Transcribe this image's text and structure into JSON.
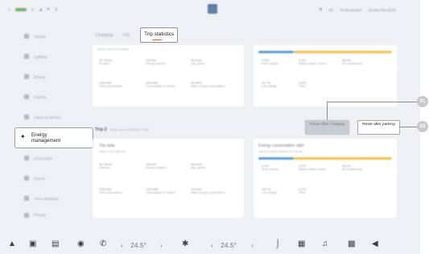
{
  "status_bar": {
    "left": [
      "≡",
      "⊙",
      "◢",
      "⚑",
      "⬆"
    ],
    "right": [
      "✱",
      "5G",
      "Ts Iks service",
      "16 Mar Sat 19:52"
    ]
  },
  "sidebar": {
    "items": [
      {
        "label": "Vehicle",
        "icon": "car-icon"
      },
      {
        "label": "Lighting",
        "icon": "light-icon"
      },
      {
        "label": "Driving",
        "icon": "steering-icon"
      },
      {
        "label": "Exterior",
        "icon": "door-icon"
      },
      {
        "label": "Safety & Service",
        "icon": "shield-icon"
      },
      {
        "label": "Energy management",
        "icon": "energy-icon",
        "active": true
      },
      {
        "label": "Connection",
        "icon": "link-icon"
      },
      {
        "label": "Sound",
        "icon": "sound-icon"
      },
      {
        "label": "Voice assistant",
        "icon": "mic-icon"
      },
      {
        "label": "Privacy",
        "icon": "lock-icon"
      }
    ]
  },
  "tabs": {
    "charging": "Charging",
    "v2l": "V2L",
    "trip_statistics": "Trip statistics"
  },
  "card1": {
    "title": "",
    "subtitle": "Values since last charge",
    "metrics": [
      {
        "label": "Duration",
        "value": "3h 15min"
      },
      {
        "label": "Driving distance",
        "value": "228 km"
      },
      {
        "label": "Avg. speed",
        "value": "46 km/h"
      },
      {
        "label": "Total consumption",
        "value": "228 kWh"
      },
      {
        "label": "Consumption in motion",
        "value": "228 kWh"
      },
      {
        "label": "Static energy consumption",
        "value": "28 kWh"
      }
    ],
    "right_metrics": [
      {
        "label": "Drive system",
        "value": "0.0%"
      },
      {
        "label": "Battery status control",
        "value": "0.0%"
      },
      {
        "label": "Air conditioning",
        "value": "36.5%"
      },
      {
        "label": "Low voltage",
        "value": "49.7%"
      },
      {
        "label": "Other",
        "value": "0.0%"
      }
    ]
  },
  "trip2": {
    "heading": "Trip 2",
    "heading_sub": "Values since 2024/03/01 12:00",
    "title": "Trip data",
    "subtitle": "Values since last trip",
    "metrics": [
      {
        "label": "Distance",
        "value": "3h 15min"
      },
      {
        "label": "Driving distance",
        "value": "228 km"
      },
      {
        "label": "Avg. speed",
        "value": "46 km/h"
      },
      {
        "label": "Total consumption",
        "value": "228 kWh"
      },
      {
        "label": "Consumption in motion",
        "value": "228 kWh"
      },
      {
        "label": "Static energy consumption",
        "value": "28 kWh"
      }
    ],
    "right_title": "Energy consumption ratio",
    "right_subtitle": "Typical energy statistics for this trip",
    "right_metrics": [
      {
        "label": "Drive system",
        "value": "0.0%"
      },
      {
        "label": "Battery status control",
        "value": "0.0%"
      },
      {
        "label": "Air conditioning",
        "value": "36.5%"
      },
      {
        "label": "Low voltage",
        "value": "49.7%"
      },
      {
        "label": "Other",
        "value": "0.0%"
      }
    ]
  },
  "buttons": {
    "reset_after_charging": "Reset after charging",
    "reset_after_parking": "Reset after parking"
  },
  "callouts": [
    "01",
    "02"
  ],
  "dock": {
    "temp_left": "24.5°",
    "temp_right": "24.5°"
  },
  "colors": {
    "accent": "#e0602a",
    "bar_blue": "#5b9bd5",
    "bar_yellow": "#f0c24b",
    "background": "#eef0f3"
  }
}
